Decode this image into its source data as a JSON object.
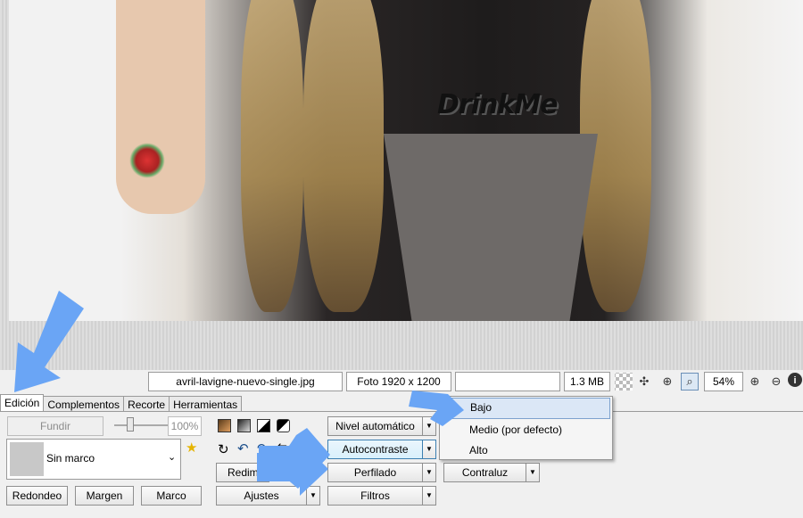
{
  "statusbar": {
    "filename": "avril-lavigne-nuevo-single.jpg",
    "photo_info": "Foto 1920 x 1200",
    "empty_field": "",
    "filesize": "1.3 MB",
    "zoom": "54%"
  },
  "photo": {
    "necklace_text": "DrinkMe"
  },
  "tabs": [
    {
      "label": "Edición",
      "selected": true
    },
    {
      "label": "Complementos"
    },
    {
      "label": "Recorte"
    },
    {
      "label": "Herramientas"
    }
  ],
  "panel": {
    "fundir_label": "Fundir",
    "opacity_value": "100%",
    "frame_select": "Sin marco",
    "redondeo_label": "Redondeo",
    "margen_label": "Margen",
    "marco_label": "Marco",
    "nivel_label": "Nivel automático",
    "autocontraste_label": "Autocontraste",
    "perfilado_label": "Perfilado",
    "filtros_label": "Filtros",
    "redim_label": "Redim",
    "ajustes_label": "Ajustes",
    "contraluz_label": "Contraluz"
  },
  "dropdown": {
    "items": [
      "Bajo",
      "Medio (por defecto)",
      "Alto"
    ],
    "highlighted_index": 0
  },
  "colors": {
    "arrow": "#6aa5f5",
    "highlight": "#dbe7f6"
  }
}
